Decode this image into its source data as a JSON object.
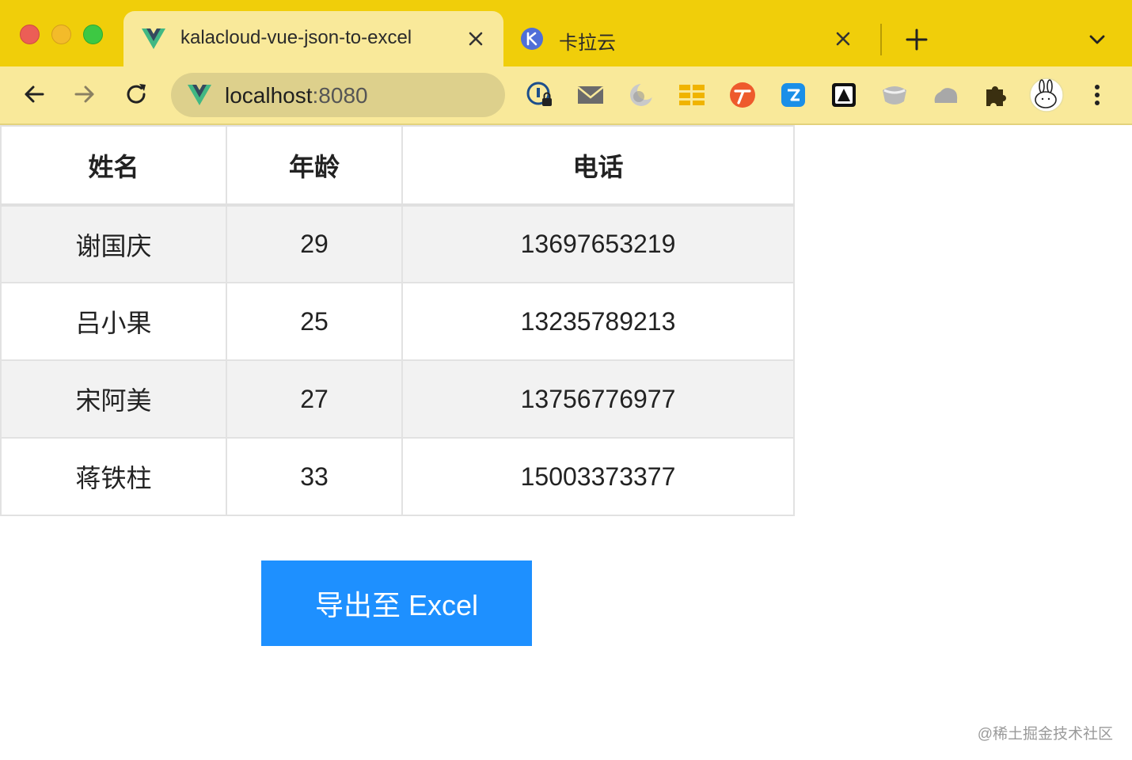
{
  "browser": {
    "tabs": [
      {
        "title": "kalacloud-vue-json-to-excel",
        "favicon": "vue-logo-icon",
        "active": true
      },
      {
        "title": "卡拉云",
        "favicon": "kalacloud-icon",
        "active": false
      }
    ],
    "address_bar": {
      "host": "localhost",
      "port": ":8080"
    },
    "extensions": [
      "lock-shield-icon",
      "mail-icon",
      "moon-icon",
      "grid-icon",
      "translate-icon",
      "blue-badge-icon",
      "dark-square-icon",
      "bowl-icon",
      "cloud-icon",
      "puzzle-icon",
      "rabbit-avatar-icon"
    ],
    "colors": {
      "tabstrip": "#f0ce0a",
      "toolbar": "#f9e99a"
    }
  },
  "table": {
    "headers": [
      "姓名",
      "年龄",
      "电话"
    ],
    "rows": [
      [
        "谢国庆",
        "29",
        "13697653219"
      ],
      [
        "吕小果",
        "25",
        "13235789213"
      ],
      [
        "宋阿美",
        "27",
        "13756776977"
      ],
      [
        "蒋铁柱",
        "33",
        "15003373377"
      ]
    ]
  },
  "export_button": {
    "label": "导出至 Excel",
    "color": "#1e90ff"
  },
  "watermark": "@稀土掘金技术社区"
}
